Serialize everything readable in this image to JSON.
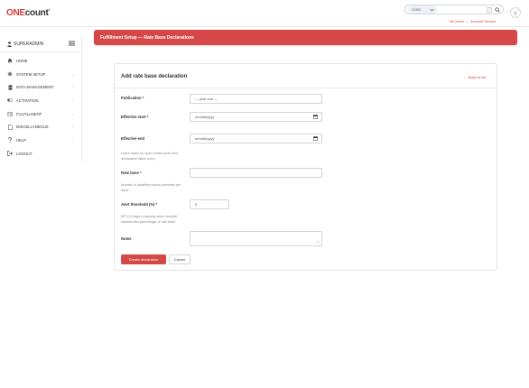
{
  "header": {
    "logo_one": "ONE",
    "logo_count": "count",
    "logo_tm": "®",
    "search_select": "GOID",
    "search_placeholder": "",
    "slash_key": "/",
    "link_all_users": "All Users",
    "link_sep": "|",
    "link_account_search": "Account Search",
    "collapse_icon": "chevron-left-icon"
  },
  "sidebar": {
    "user": "SUPERADMIN",
    "items": [
      {
        "label": "HOME",
        "icon": "home-icon",
        "chevron": ""
      },
      {
        "label": "SYSTEM SETUP",
        "icon": "gear-icon",
        "chevron": "›"
      },
      {
        "label": "DATA MANAGEMENT",
        "icon": "database-icon",
        "chevron": "›"
      },
      {
        "label": "ACTIVATION",
        "icon": "toggle-icon",
        "chevron": "›"
      },
      {
        "label": "FULFILLMENT",
        "icon": "id-card-icon",
        "chevron": "›"
      },
      {
        "label": "MISCELLANEOUS",
        "icon": "file-icon",
        "chevron": "›"
      },
      {
        "label": "HELP",
        "icon": "question-icon",
        "chevron": "›"
      },
      {
        "label": "LOGOUT",
        "icon": "logout-icon",
        "chevron": ""
      }
    ]
  },
  "page": {
    "title": "Fulfillment Setup — Rate Base Declarations"
  },
  "form": {
    "title": "Add rate base declaration",
    "back_link": "← Back to list",
    "publication": {
      "label": "Publication *",
      "value": "— pick one —"
    },
    "effective_start": {
      "label": "Effective start *",
      "value": "mm/dd/yyyy"
    },
    "effective_end": {
      "label": "Effective end",
      "value": "mm/dd/yyyy",
      "help": "Leave blank for open-ended (until next declaration takes over)."
    },
    "rate_base": {
      "label": "Rate base *",
      "value": "",
      "help": "Number of qualified copies promised per issue."
    },
    "alert_threshold": {
      "label": "Alert threshold (%) *",
      "value": "5",
      "help": "RPT-12 flags a warning when shortfall reaches this percentage of rate base."
    },
    "notes": {
      "label": "Notes",
      "value": ""
    },
    "create_button": "Create declaration",
    "cancel_button": "Cancel"
  },
  "colors": {
    "brand_red": "#d64848",
    "link_red": "#d63c3c"
  }
}
